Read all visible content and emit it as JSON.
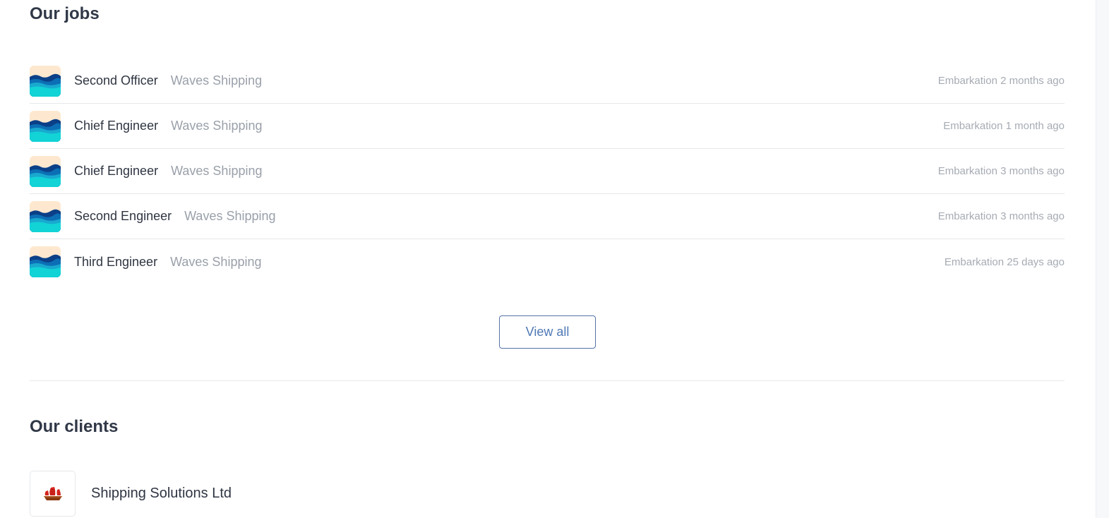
{
  "jobs_section": {
    "title": "Our jobs",
    "jobs": [
      {
        "title": "Second Officer",
        "company": "Waves Shipping",
        "time": "Embarkation 2 months ago",
        "logo_icon": "waves-logo-icon"
      },
      {
        "title": "Chief Engineer",
        "company": "Waves Shipping",
        "time": "Embarkation 1 month ago",
        "logo_icon": "waves-logo-icon"
      },
      {
        "title": "Chief Engineer",
        "company": "Waves Shipping",
        "time": "Embarkation 3 months ago",
        "logo_icon": "waves-logo-icon"
      },
      {
        "title": "Second Engineer",
        "company": "Waves Shipping",
        "time": "Embarkation 3 months ago",
        "logo_icon": "waves-logo-icon"
      },
      {
        "title": "Third Engineer",
        "company": "Waves Shipping",
        "time": "Embarkation 25 days ago",
        "logo_icon": "waves-logo-icon"
      }
    ],
    "view_all_label": "View all"
  },
  "clients_section": {
    "title": "Our clients",
    "clients": [
      {
        "name": "Shipping Solutions Ltd",
        "logo_icon": "junk-ship-icon"
      }
    ]
  },
  "colors": {
    "heading": "#303847",
    "muted_text": "#9aa0aa",
    "accent": "#4f79b5",
    "divider": "#e6e8eb"
  }
}
